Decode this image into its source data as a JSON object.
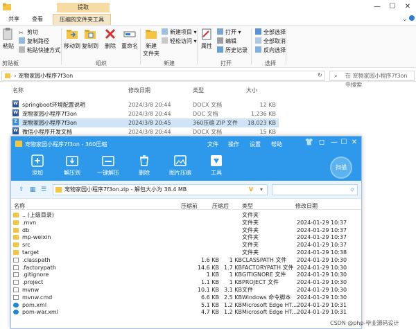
{
  "explorer": {
    "context_tab": "提取",
    "ribbon_tabs": [
      {
        "label": "共享"
      },
      {
        "label": "查看"
      },
      {
        "label": "压缩的文件夹工具"
      }
    ],
    "title": "宠物家园小程序7f3on",
    "clipboard": {
      "paste": "粘贴",
      "cut": "剪切",
      "copy_path": "复制路径",
      "paste_shortcut": "粘贴快捷方式",
      "group": "剪贴板"
    },
    "organize": {
      "move_to": "移动到",
      "copy_to": "复制到",
      "delete": "删除",
      "rename": "重命名",
      "group": "组织"
    },
    "new": {
      "new_folder_line1": "新建",
      "new_folder_line2": "文件夹",
      "new_item": "新建项目",
      "easy_access": "轻松访问",
      "group": "新建"
    },
    "open": {
      "properties": "属性",
      "open": "打开",
      "edit": "编辑",
      "history": "历史记录",
      "group": "打开"
    },
    "select": {
      "select_all": "全部选择",
      "select_none": "全部取消",
      "invert": "反向选择",
      "group": "选择"
    },
    "address": "宠物家园小程序7f3on",
    "search_placeholder": "在 宠物家园小程序7f3on 中搜索",
    "columns": {
      "name": "名称",
      "modified": "修改日期",
      "type": "类型",
      "size": "大小"
    },
    "files": [
      {
        "name": "springboot环境配置说明",
        "modified": "2024/3/8 20:44",
        "type": "DOCX 文档",
        "size": "12 KB"
      },
      {
        "name": "宠物家园小程序7f3on",
        "modified": "2024/3/8 20:44",
        "type": "DOC 文档",
        "size": "1,236 KB"
      },
      {
        "name": "宠物家园小程序7f3on",
        "modified": "2024/3/8 20:45",
        "type": "360压缩 ZIP 文件",
        "size": "18,023 KB"
      },
      {
        "name": "微信小程序开发文档",
        "modified": "2024/3/8 20:44",
        "type": "DOCX 文档",
        "size": "15 KB"
      }
    ]
  },
  "zip": {
    "title": "宠物家园小程序7f3on - 360压缩",
    "menu": [
      "文件",
      "操作",
      "设置",
      "帮助"
    ],
    "tools": [
      {
        "label": "添加",
        "icon": "add-icon"
      },
      {
        "label": "解压到",
        "icon": "extract-to-icon"
      },
      {
        "label": "一键解压",
        "icon": "one-click-extract-icon"
      },
      {
        "label": "删除",
        "icon": "trash-icon"
      },
      {
        "label": "图片压缩",
        "icon": "image-compress-icon"
      },
      {
        "label": "工具",
        "icon": "tools-icon"
      }
    ],
    "scan_label": "扫描",
    "path": "宠物家园小程序7f3on.zip - 解包大小为 38.4 MB",
    "columns": {
      "name": "名称",
      "compressed": "压缩前",
      "size": "压缩后",
      "type": "类型",
      "modified": "修改日期"
    },
    "rows": [
      {
        "name": ".. (上级目录)",
        "compressed": "",
        "size": "",
        "type": "文件夹",
        "modified": "",
        "kind": "folder"
      },
      {
        "name": ".mvn",
        "compressed": "",
        "size": "",
        "type": "文件夹",
        "modified": "2024-01-29 10:37",
        "kind": "folder"
      },
      {
        "name": "db",
        "compressed": "",
        "size": "",
        "type": "文件夹",
        "modified": "2024-01-29 10:37",
        "kind": "folder"
      },
      {
        "name": "mp-weixin",
        "compressed": "",
        "size": "",
        "type": "文件夹",
        "modified": "2024-01-29 10:37",
        "kind": "folder"
      },
      {
        "name": "src",
        "compressed": "",
        "size": "",
        "type": "文件夹",
        "modified": "2024-01-29 10:37",
        "kind": "folder"
      },
      {
        "name": "target",
        "compressed": "",
        "size": "",
        "type": "文件夹",
        "modified": "2024-01-29 10:38",
        "kind": "folder"
      },
      {
        "name": ".classpath",
        "compressed": "1.6 KB",
        "size": "1 KB",
        "type": "CLASSPATH 文件",
        "modified": "2024-01-29 10:30",
        "kind": "file"
      },
      {
        "name": ".factorypath",
        "compressed": "14.6 KB",
        "size": "1.7 KB",
        "type": "FACTORYPATH 文件",
        "modified": "2024-01-29 10:30",
        "kind": "file"
      },
      {
        "name": ".gitignore",
        "compressed": "1 KB",
        "size": "1 KB",
        "type": "GITIGNORE 文件",
        "modified": "2024-01-29 10:30",
        "kind": "file"
      },
      {
        "name": ".project",
        "compressed": "1.1 KB",
        "size": "1 KB",
        "type": "PROJECT 文件",
        "modified": "2024-01-29 10:30",
        "kind": "file"
      },
      {
        "name": "mvnw",
        "compressed": "10.1 KB",
        "size": "3.1 KB",
        "type": "文件",
        "modified": "2024-01-29 10:30",
        "kind": "file"
      },
      {
        "name": "mvnw.cmd",
        "compressed": "6.6 KB",
        "size": "2.5 KB",
        "type": "Windows 命令脚本",
        "modified": "2024-01-29 10:30",
        "kind": "file"
      },
      {
        "name": "pom.xml",
        "compressed": "5.1 KB",
        "size": "1.2 KB",
        "type": "Microsoft Edge HT...",
        "modified": "2024-01-29 10:31",
        "kind": "edge"
      },
      {
        "name": "pom-war.xml",
        "compressed": "4.7 KB",
        "size": "1.2 KB",
        "type": "Microsoft Edge HT...",
        "modified": "2024-01-29 10:31",
        "kind": "edge"
      }
    ]
  },
  "watermark": "CSDN @php-毕业源码设计"
}
